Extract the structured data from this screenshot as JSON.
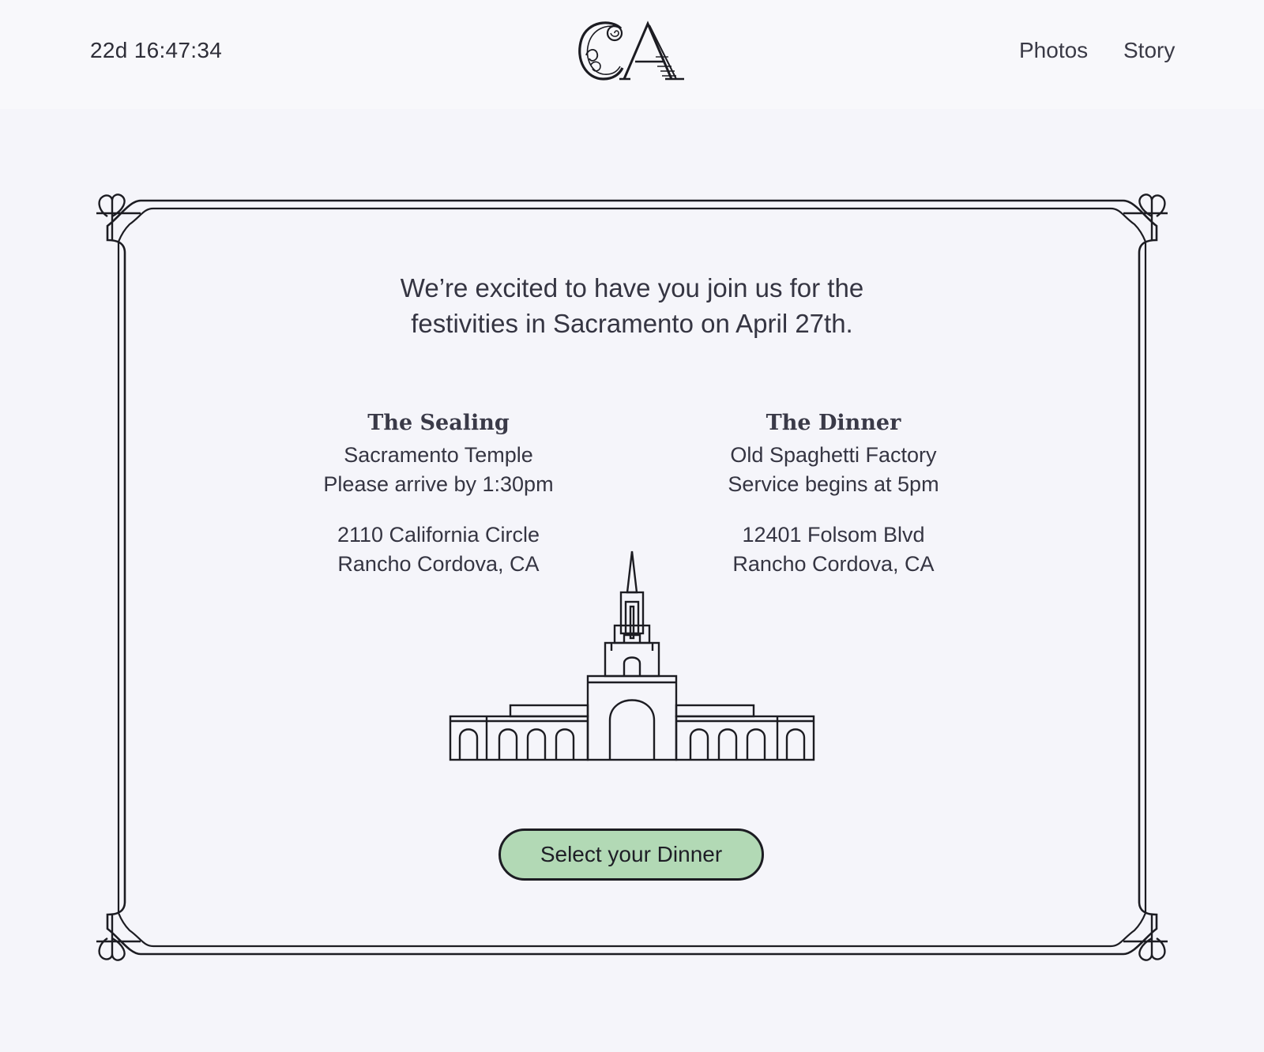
{
  "header": {
    "countdown": "22d 16:47:34",
    "logo_monogram": "CA",
    "nav": [
      {
        "label": "Photos"
      },
      {
        "label": "Story"
      }
    ]
  },
  "card": {
    "intro_line1": "We’re excited to have you join us for the",
    "intro_line2": "festivities in Sacramento on April 27th.",
    "events": [
      {
        "title": "The Sealing",
        "venue": "Sacramento Temple",
        "timing": "Please arrive by 1:30pm",
        "address_line1": "2110 California Circle",
        "address_line2": "Rancho Cordova, CA"
      },
      {
        "title": "The Dinner",
        "venue": "Old Spaghetti Factory",
        "timing": "Service begins at 5pm",
        "address_line1": "12401 Folsom Blvd",
        "address_line2": "Rancho Cordova, CA"
      }
    ],
    "illustration": "temple-illustration",
    "cta_label": "Select your Dinner"
  },
  "colors": {
    "page_background": "#f5f5fa",
    "header_background": "#f8f8fb",
    "text": "#333340",
    "line_art": "#1c1c22",
    "cta_fill": "#b2d9b5"
  }
}
